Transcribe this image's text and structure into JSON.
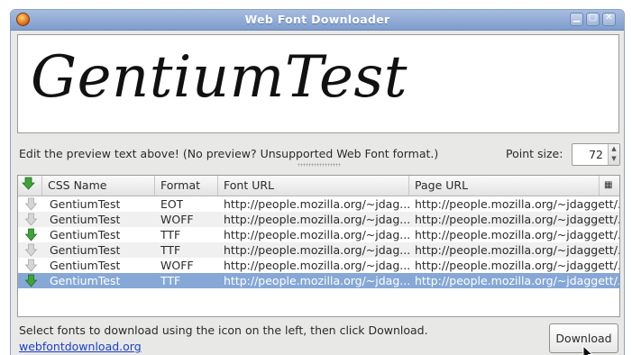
{
  "window": {
    "title": "Web Font Downloader"
  },
  "preview": {
    "text": "GentiumTest"
  },
  "hint_text": "Edit the preview text above! (No preview? Unsupported Web Font format.)",
  "point_size": {
    "label": "Point size:",
    "value": "72"
  },
  "table": {
    "columns": [
      "CSS Name",
      "Format",
      "Font URL",
      "Page URL"
    ],
    "rows": [
      {
        "css_name": "GentiumTest",
        "format": "EOT",
        "font_url": "http://people.mozilla.org/~jdag...",
        "page_url": "http://people.mozilla.org/~jdaggett/...",
        "icon": "download-arrow-gray"
      },
      {
        "css_name": "GentiumTest",
        "format": "WOFF",
        "font_url": "http://people.mozilla.org/~jdag...",
        "page_url": "http://people.mozilla.org/~jdaggett/...",
        "icon": "download-arrow-gray"
      },
      {
        "css_name": "GentiumTest",
        "format": "TTF",
        "font_url": "http://people.mozilla.org/~jdag...",
        "page_url": "http://people.mozilla.org/~jdaggett/...",
        "icon": "download-arrow-green"
      },
      {
        "css_name": "GentiumTest",
        "format": "TTF",
        "font_url": "http://people.mozilla.org/~jdag...",
        "page_url": "http://people.mozilla.org/~jdaggett/...",
        "icon": "download-arrow-gray"
      },
      {
        "css_name": "GentiumTest",
        "format": "WOFF",
        "font_url": "http://people.mozilla.org/~jdag...",
        "page_url": "http://people.mozilla.org/~jdaggett/...",
        "icon": "download-arrow-gray"
      },
      {
        "css_name": "GentiumTest",
        "format": "TTF",
        "font_url": "http://people.mozilla.org/~jdag...",
        "page_url": "http://people.mozilla.org/~jdaggett/...",
        "icon": "download-arrow-green",
        "selected": true
      }
    ]
  },
  "status_text": "Select fonts to download using the icon on the left, then click Download.",
  "link_text": "webfontdownload.org",
  "download_label": "Download",
  "colors": {
    "titlebar": "#8fa9d6",
    "selection": "#86a8d6",
    "link": "#1a40cc",
    "green_arrow": "#3fa33a"
  }
}
